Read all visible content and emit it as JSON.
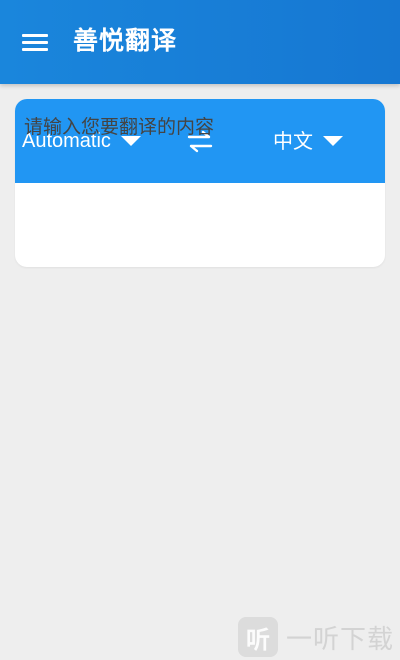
{
  "app": {
    "title": "善悦翻译"
  },
  "toolbar": {
    "menu_icon": "hamburger-menu-icon"
  },
  "translator": {
    "source_language": "Automatic",
    "target_language": "中文",
    "swap_icon": "swap-arrows-icon",
    "input_placeholder": "请输入您要翻译的内容"
  },
  "watermark": {
    "logo_text": "听",
    "text": "一听下载"
  },
  "colors": {
    "appbar": "#1a86dc",
    "language_bar": "#2196f3",
    "background": "#eeeeee",
    "card": "#ffffff"
  }
}
